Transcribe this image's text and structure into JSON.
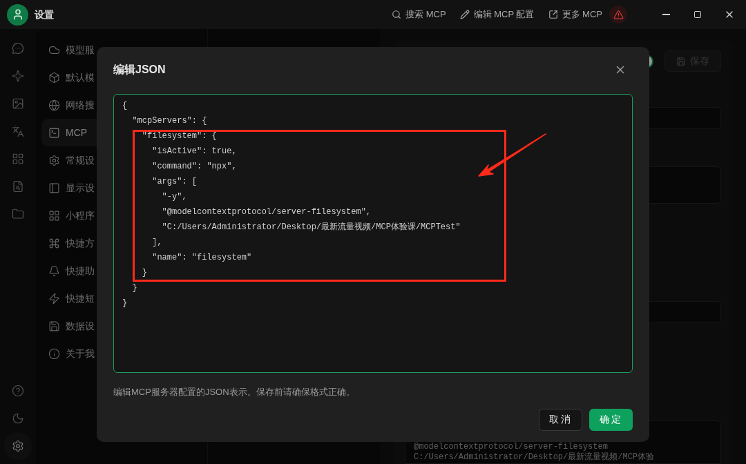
{
  "window": {
    "title": "设置"
  },
  "toolbar": [
    {
      "kind": "search",
      "label": "搜索 MCP"
    },
    {
      "kind": "edit",
      "label": "编辑 MCP 配置"
    },
    {
      "kind": "external",
      "label": "更多 MCP"
    },
    {
      "kind": "warning"
    }
  ],
  "rail": [
    {
      "kind": "chat",
      "selected": false
    },
    {
      "kind": "sparkle",
      "selected": false
    },
    {
      "kind": "image",
      "selected": false
    },
    {
      "kind": "translate",
      "selected": false
    },
    {
      "kind": "apps",
      "selected": false
    },
    {
      "kind": "search-doc",
      "selected": false
    },
    {
      "kind": "folder",
      "selected": false
    }
  ],
  "rail_bottom": [
    {
      "kind": "help",
      "selected": false
    },
    {
      "kind": "theme",
      "selected": false
    },
    {
      "kind": "settings",
      "selected": true
    }
  ],
  "menu": [
    {
      "kind": "cloud",
      "label": "模型服",
      "selected": false
    },
    {
      "kind": "box",
      "label": "默认模",
      "selected": false
    },
    {
      "kind": "globe",
      "label": "网络搜",
      "selected": false
    },
    {
      "kind": "terminal",
      "label": "MCP",
      "selected": true
    },
    {
      "kind": "settings",
      "label": "常规设",
      "selected": false
    },
    {
      "kind": "display",
      "label": "显示设",
      "selected": false
    },
    {
      "kind": "apps",
      "label": "小程序",
      "selected": false
    },
    {
      "kind": "command",
      "label": "快捷方",
      "selected": false
    },
    {
      "kind": "bell",
      "label": "快捷助",
      "selected": false
    },
    {
      "kind": "zap",
      "label": "快捷短",
      "selected": false
    },
    {
      "kind": "save",
      "label": "数据设",
      "selected": false
    },
    {
      "kind": "info",
      "label": "关于我",
      "selected": false
    }
  ],
  "server_panel": {
    "toggle": {
      "on": true
    },
    "save_button": "保存",
    "code_lines": [
      "@modelcontextprotocol/server-filesystem",
      "C:/Users/Administrator/Desktop/最新流量视频/MCP体验"
    ]
  },
  "dialog": {
    "title": "编辑JSON",
    "editor_lines": [
      "{",
      "  \"mcpServers\": {",
      "    \"filesystem\": {",
      "      \"isActive\": true,",
      "      \"command\": \"npx\",",
      "      \"args\": [",
      "        \"-y\",",
      "        \"@modelcontextprotocol/server-filesystem\",",
      "        \"C:/Users/Administrator/Desktop/最新流量视频/MCP体验课/MCPTest\"",
      "      ],",
      "      \"name\": \"filesystem\"",
      "    }",
      "  }",
      "}"
    ],
    "hint": "编辑MCP服务器配置的JSON表示。保存前请确保格式正确。",
    "buttons": [
      {
        "kind": "secondary",
        "label": "取消"
      },
      {
        "kind": "primary",
        "label": "确定"
      }
    ]
  }
}
